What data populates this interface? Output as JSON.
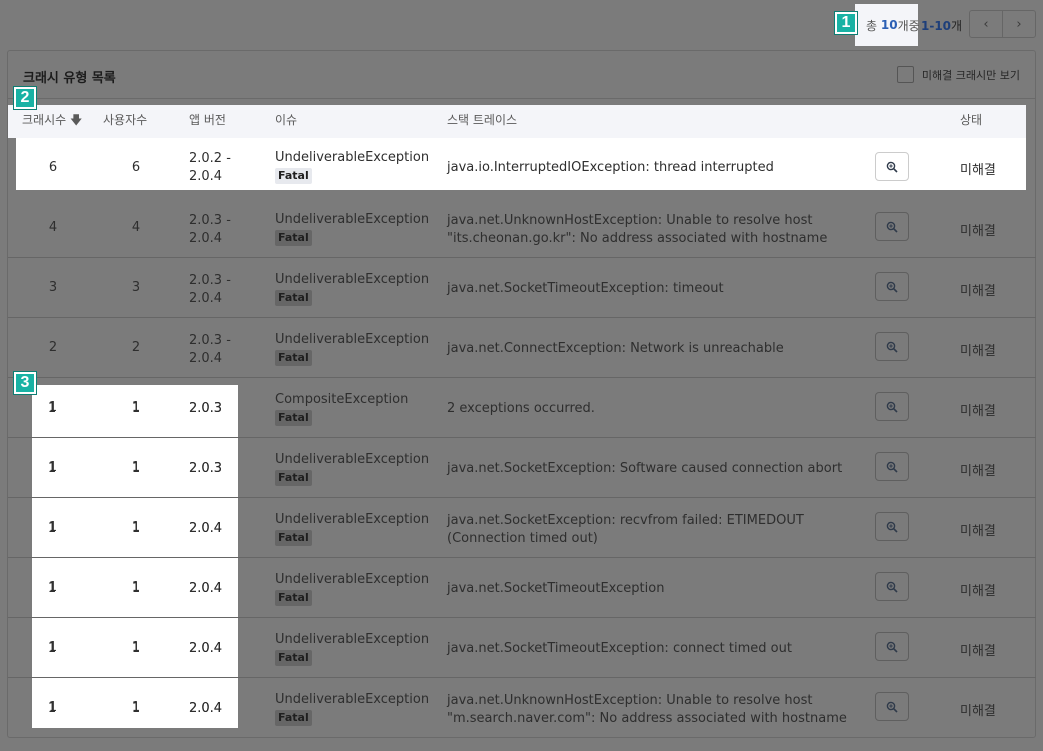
{
  "pager": {
    "total_prefix": "총",
    "total_count": "10",
    "total_suffix": "개중",
    "range": "1-10",
    "range_suffix": "개",
    "prev_icon": "‹",
    "next_icon": "›"
  },
  "badges": [
    "1",
    "2",
    "3"
  ],
  "panel": {
    "title": "크래시 유형 목록",
    "filter_label": "미해결 크래시만 보기"
  },
  "columns": {
    "crash_count": "크래시수",
    "sort_icon": "🡇",
    "user_count": "사용자수",
    "app_version": "앱 버전",
    "issue": "이슈",
    "stack_trace": "스택 트레이스",
    "status": "상태"
  },
  "rows": [
    {
      "crash": "6",
      "users": "6",
      "ver1": "2.0.2 -",
      "ver2": "2.0.4",
      "issue": "UndeliverableException",
      "level": "Fatal",
      "stack1": "java.io.InterruptedIOException: thread interrupted",
      "stack2": "",
      "status": "미해결"
    },
    {
      "crash": "4",
      "users": "4",
      "ver1": "2.0.3 -",
      "ver2": "2.0.4",
      "issue": "UndeliverableException",
      "level": "Fatal",
      "stack1": "java.net.UnknownHostException: Unable to resolve host",
      "stack2": "\"its.cheonan.go.kr\": No address associated with hostname",
      "status": "미해결"
    },
    {
      "crash": "3",
      "users": "3",
      "ver1": "2.0.3 -",
      "ver2": "2.0.4",
      "issue": "UndeliverableException",
      "level": "Fatal",
      "stack1": "java.net.SocketTimeoutException: timeout",
      "stack2": "",
      "status": "미해결"
    },
    {
      "crash": "2",
      "users": "2",
      "ver1": "2.0.3 -",
      "ver2": "2.0.4",
      "issue": "UndeliverableException",
      "level": "Fatal",
      "stack1": "java.net.ConnectException: Network is unreachable",
      "stack2": "",
      "status": "미해결"
    },
    {
      "crash": "1",
      "users": "1",
      "ver1": "2.0.3",
      "ver2": "",
      "issue": "CompositeException",
      "level": "Fatal",
      "stack1": "2 exceptions occurred.",
      "stack2": "",
      "status": "미해결"
    },
    {
      "crash": "1",
      "users": "1",
      "ver1": "2.0.3",
      "ver2": "",
      "issue": "UndeliverableException",
      "level": "Fatal",
      "stack1": "java.net.SocketException: Software caused connection abort",
      "stack2": "",
      "status": "미해결"
    },
    {
      "crash": "1",
      "users": "1",
      "ver1": "2.0.4",
      "ver2": "",
      "issue": "UndeliverableException",
      "level": "Fatal",
      "stack1": "java.net.SocketException: recvfrom failed: ETIMEDOUT",
      "stack2": "(Connection timed out)",
      "status": "미해결"
    },
    {
      "crash": "1",
      "users": "1",
      "ver1": "2.0.4",
      "ver2": "",
      "issue": "UndeliverableException",
      "level": "Fatal",
      "stack1": "java.net.SocketTimeoutException",
      "stack2": "",
      "status": "미해결"
    },
    {
      "crash": "1",
      "users": "1",
      "ver1": "2.0.4",
      "ver2": "",
      "issue": "UndeliverableException",
      "level": "Fatal",
      "stack1": "java.net.SocketTimeoutException: connect timed out",
      "stack2": "",
      "status": "미해결"
    },
    {
      "crash": "1",
      "users": "1",
      "ver1": "2.0.4",
      "ver2": "",
      "issue": "UndeliverableException",
      "level": "Fatal",
      "stack1": "java.net.UnknownHostException: Unable to resolve host",
      "stack2": "\"m.search.naver.com\": No address associated with hostname",
      "status": "미해결"
    }
  ]
}
